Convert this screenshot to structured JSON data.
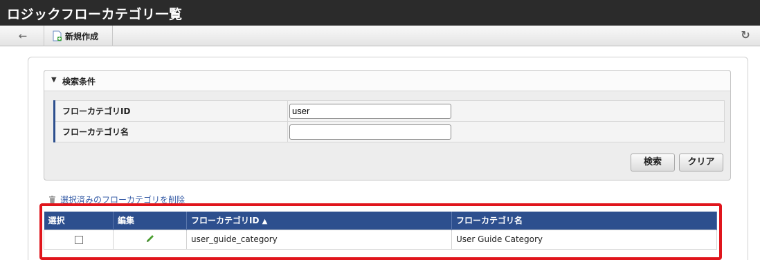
{
  "window": {
    "title": "ロジックフローカテゴリ一覧"
  },
  "toolbar": {
    "back_icon": "arrow-left-icon",
    "new_label": "新規作成",
    "new_icon": "new-document-icon",
    "refresh_icon": "refresh-icon"
  },
  "search": {
    "header_label": "検索条件",
    "fields": [
      {
        "label": "フローカテゴリID",
        "value": "user",
        "placeholder": ""
      },
      {
        "label": "フローカテゴリ名",
        "value": "",
        "placeholder": ""
      }
    ],
    "search_button": "検索",
    "clear_button": "クリア"
  },
  "results": {
    "delete_label": "選択済みのフローカテゴリを削除",
    "delete_icon": "trash-icon",
    "columns": [
      "選択",
      "編集",
      "フローカテゴリID",
      "フローカテゴリ名"
    ],
    "sort_icon": "sort-icon",
    "rows": [
      {
        "id": "user_guide_category",
        "name": "User Guide Category"
      }
    ]
  },
  "colors": {
    "header_bg": "#2d4f8e",
    "highlight": "#e0151c",
    "title_bar": "#2b2b2b"
  }
}
